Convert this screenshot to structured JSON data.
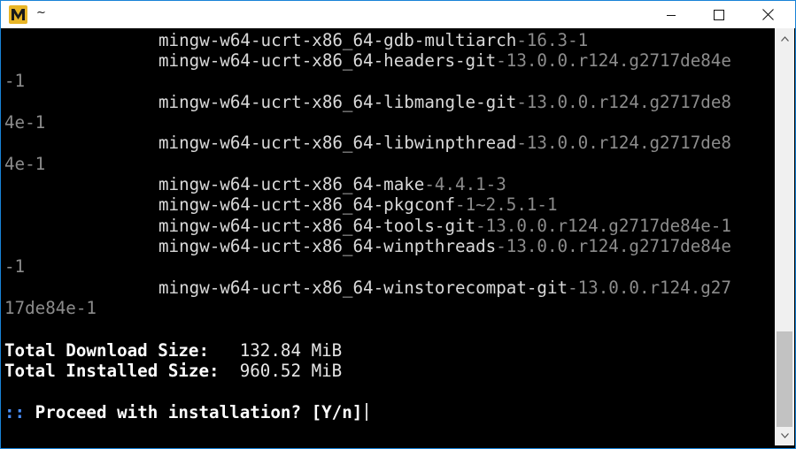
{
  "window": {
    "title": "~",
    "app_icon": "msys2-mintty-icon",
    "controls": {
      "minimize": "minimize-icon",
      "maximize": "maximize-icon",
      "close": "close-icon"
    }
  },
  "terminal": {
    "lines": [
      {
        "name": "mingw-w64-ucrt-x86_64-gdb-multiarch",
        "version": "-16.3-1"
      },
      {
        "name": "mingw-w64-ucrt-x86_64-headers-git",
        "version": "-13.0.0.r124.g2717de84e"
      },
      {
        "wrap": "-1"
      },
      {
        "name": "mingw-w64-ucrt-x86_64-libmangle-git",
        "version": "-13.0.0.r124.g2717de8"
      },
      {
        "wrap": "4e-1"
      },
      {
        "name": "mingw-w64-ucrt-x86_64-libwinpthread",
        "version": "-13.0.0.r124.g2717de8"
      },
      {
        "wrap": "4e-1"
      },
      {
        "name": "mingw-w64-ucrt-x86_64-make",
        "version": "-4.4.1-3"
      },
      {
        "name": "mingw-w64-ucrt-x86_64-pkgconf",
        "version": "-1~2.5.1-1"
      },
      {
        "name": "mingw-w64-ucrt-x86_64-tools-git",
        "version": "-13.0.0.r124.g2717de84e-1"
      },
      {
        "name": "mingw-w64-ucrt-x86_64-winpthreads",
        "version": "-13.0.0.r124.g2717de84e"
      },
      {
        "wrap": "-1"
      },
      {
        "name": "mingw-w64-ucrt-x86_64-winstorecompat-git",
        "version": "-13.0.0.r124.g27"
      },
      {
        "wrap": "17de84e-1"
      }
    ],
    "total_download_label": "Total Download Size:",
    "total_download_value": "132.84 MiB",
    "total_installed_label": "Total Installed Size:",
    "total_installed_value": "960.52 MiB",
    "prompt_marker": "::",
    "prompt_text": "Proceed with installation? [Y/n]"
  },
  "scrollbar": {
    "position_fraction": 0.74,
    "up_icon": "chevron-up-icon",
    "down_icon": "chevron-down-icon"
  }
}
